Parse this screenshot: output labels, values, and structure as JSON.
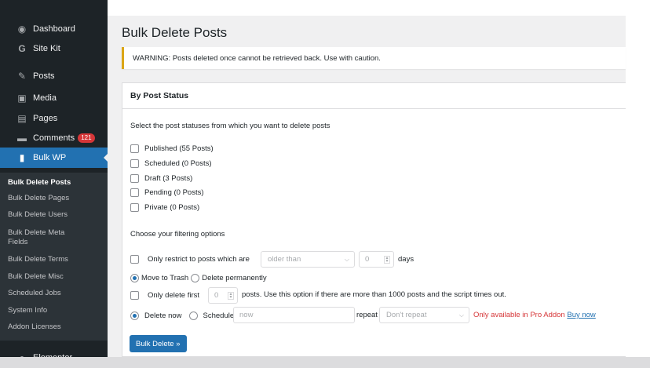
{
  "sidebar": {
    "items": [
      {
        "label": "Dashboard",
        "icon": "dashboard-icon",
        "glyph": "◉"
      },
      {
        "label": "Site Kit",
        "icon": "sitekit-icon",
        "glyph": "G"
      },
      {
        "label": "Posts",
        "icon": "pushpin-icon",
        "glyph": "✎"
      },
      {
        "label": "Media",
        "icon": "media-icon",
        "glyph": "▣"
      },
      {
        "label": "Pages",
        "icon": "pages-icon",
        "glyph": "▤"
      },
      {
        "label": "Comments",
        "icon": "comment-icon",
        "glyph": "▬",
        "badge": "121"
      },
      {
        "label": "Bulk WP",
        "icon": "trash-icon",
        "glyph": "▮"
      }
    ],
    "submenu": [
      "Bulk Delete Posts",
      "Bulk Delete Pages",
      "Bulk Delete Users",
      "Bulk Delete Meta Fields",
      "Bulk Delete Terms",
      "Bulk Delete Misc",
      "Scheduled Jobs",
      "System Info",
      "Addon Licenses"
    ],
    "elementor": {
      "label": "Elementor",
      "icon": "elementor-icon",
      "glyph": "●"
    }
  },
  "main": {
    "title": "Bulk Delete Posts",
    "warning": "WARNING: Posts deleted once cannot be retrieved back. Use with caution.",
    "box_title": "By Post Status",
    "statuses_prompt": "Select the post statuses from which you want to delete posts",
    "statuses": [
      "Published (55 Posts)",
      "Scheduled (0 Posts)",
      "Draft (3 Posts)",
      "Pending (0 Posts)",
      "Private (0 Posts)"
    ],
    "filter_heading": "Choose your filtering options",
    "restrict_label": "Only restrict to posts which are",
    "restrict_select": "older than",
    "restrict_days_value": "0",
    "restrict_days_unit": "days",
    "move_to_trash": "Move to Trash",
    "delete_permanently": "Delete permanently",
    "delete_first_label": "Only delete first",
    "delete_first_value": "0",
    "delete_first_note": "posts. Use this option if there are more than 1000 posts and the script times out.",
    "delete_now": "Delete now",
    "schedule": "Schedule",
    "schedule_value": "now",
    "repeat_label": "repeat",
    "repeat_select": "Don't repeat",
    "pro_note": "Only available in Pro Addon",
    "buy_now": "Buy now",
    "bulk_delete_button": "Bulk Delete »"
  },
  "colors": {
    "sidebar_bg": "#1d2327",
    "active_bg": "#2271b1",
    "warning_border": "#dba617",
    "badge": "#d63638",
    "pro_note": "#d63638"
  }
}
